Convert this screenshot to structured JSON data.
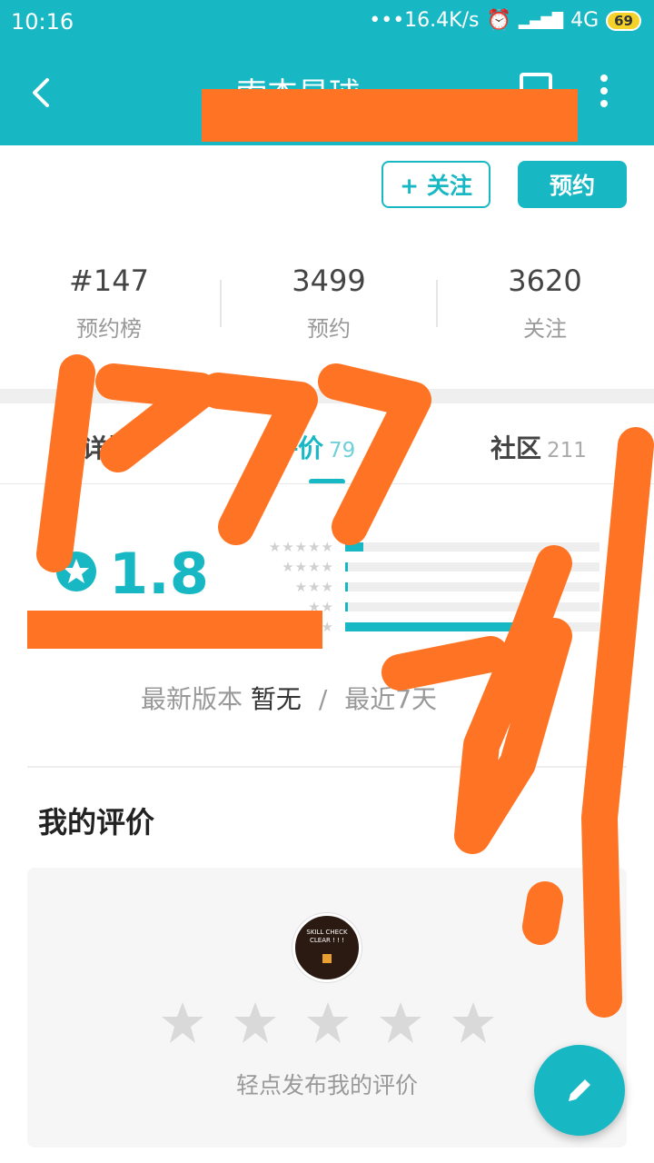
{
  "status": {
    "time": "10:16",
    "net_speed": "•••16.4K/s",
    "network": "4G",
    "battery": "69"
  },
  "appbar": {
    "title": "索杰星球"
  },
  "actions": {
    "follow_label": "+ 关注",
    "reserve_label": "预约"
  },
  "stats": [
    {
      "value": "#147",
      "label": "预约榜"
    },
    {
      "value": "3499",
      "label": "预约"
    },
    {
      "value": "3620",
      "label": "关注"
    }
  ],
  "tabs": [
    {
      "label": "详情",
      "count": ""
    },
    {
      "label": "评价",
      "count": "79"
    },
    {
      "label": "社区",
      "count": "211"
    }
  ],
  "rating": {
    "score": "1.8",
    "distribution": [
      {
        "stars": "★★★★★",
        "fraction": 0.07
      },
      {
        "stars": "★★★★",
        "fraction": 0.01
      },
      {
        "stars": "★★★",
        "fraction": 0.01
      },
      {
        "stars": "★★",
        "fraction": 0.01
      },
      {
        "stars": "★",
        "fraction": 0.85
      }
    ]
  },
  "version": {
    "label": "最新版本",
    "value": "暂无",
    "sep": "/",
    "recent": "最近7天"
  },
  "my_review": {
    "title": "我的评价",
    "avatar_text": "SKILL CHECK CLEAR ! ! !",
    "hint": "轻点发布我的评价"
  },
  "colors": {
    "accent": "#17b8c4",
    "redaction": "#ff7424"
  }
}
